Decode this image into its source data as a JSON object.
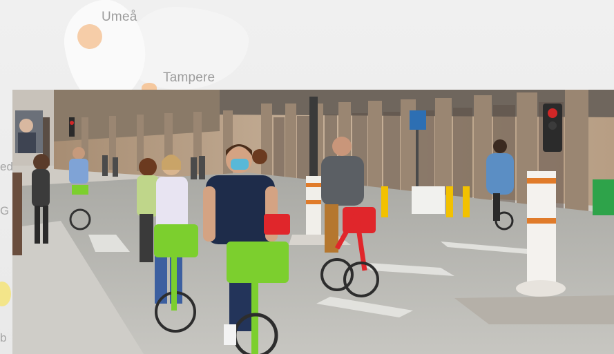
{
  "map": {
    "labels": {
      "umea": "Umeå",
      "tampere": "Tampere",
      "fragment_1": "ed",
      "fragment_2": "G",
      "fragment_3": "b"
    }
  },
  "photo": {
    "subject": "cyclists-on-city-bike-lane"
  },
  "colors": {
    "map_background": "#ececec",
    "city_dot": "#f5c89e",
    "bike_basket_green": "#7ccf2e",
    "bike_red": "#e0262b",
    "pavement": "#b9b9b4"
  }
}
